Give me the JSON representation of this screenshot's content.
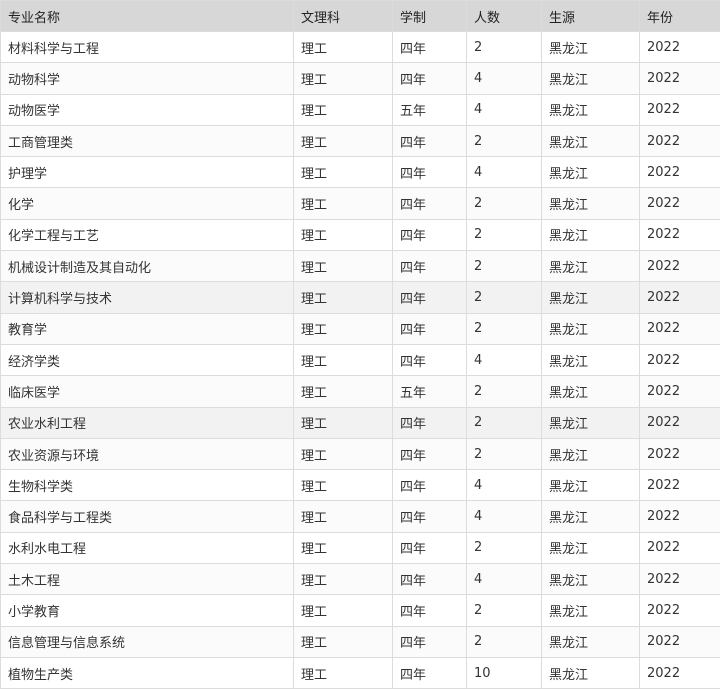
{
  "headers": [
    "专业名称",
    "文理科",
    "学制",
    "人数",
    "生源",
    "年份"
  ],
  "rows": [
    [
      "材料科学与工程",
      "理工",
      "四年",
      "2",
      "黑龙江",
      "2022"
    ],
    [
      "动物科学",
      "理工",
      "四年",
      "4",
      "黑龙江",
      "2022"
    ],
    [
      "动物医学",
      "理工",
      "五年",
      "4",
      "黑龙江",
      "2022"
    ],
    [
      "工商管理类",
      "理工",
      "四年",
      "2",
      "黑龙江",
      "2022"
    ],
    [
      "护理学",
      "理工",
      "四年",
      "4",
      "黑龙江",
      "2022"
    ],
    [
      "化学",
      "理工",
      "四年",
      "2",
      "黑龙江",
      "2022"
    ],
    [
      "化学工程与工艺",
      "理工",
      "四年",
      "2",
      "黑龙江",
      "2022"
    ],
    [
      "机械设计制造及其自动化",
      "理工",
      "四年",
      "2",
      "黑龙江",
      "2022"
    ],
    [
      "计算机科学与技术",
      "理工",
      "四年",
      "2",
      "黑龙江",
      "2022"
    ],
    [
      "教育学",
      "理工",
      "四年",
      "2",
      "黑龙江",
      "2022"
    ],
    [
      "经济学类",
      "理工",
      "四年",
      "4",
      "黑龙江",
      "2022"
    ],
    [
      "临床医学",
      "理工",
      "五年",
      "2",
      "黑龙江",
      "2022"
    ],
    [
      "农业水利工程",
      "理工",
      "四年",
      "2",
      "黑龙江",
      "2022"
    ],
    [
      "农业资源与环境",
      "理工",
      "四年",
      "2",
      "黑龙江",
      "2022"
    ],
    [
      "生物科学类",
      "理工",
      "四年",
      "4",
      "黑龙江",
      "2022"
    ],
    [
      "食品科学与工程类",
      "理工",
      "四年",
      "4",
      "黑龙江",
      "2022"
    ],
    [
      "水利水电工程",
      "理工",
      "四年",
      "2",
      "黑龙江",
      "2022"
    ],
    [
      "土木工程",
      "理工",
      "四年",
      "4",
      "黑龙江",
      "2022"
    ],
    [
      "小学教育",
      "理工",
      "四年",
      "2",
      "黑龙江",
      "2022"
    ],
    [
      "信息管理与信息系统",
      "理工",
      "四年",
      "2",
      "黑龙江",
      "2022"
    ],
    [
      "植物生产类",
      "理工",
      "四年",
      "10",
      "黑龙江",
      "2022"
    ]
  ]
}
